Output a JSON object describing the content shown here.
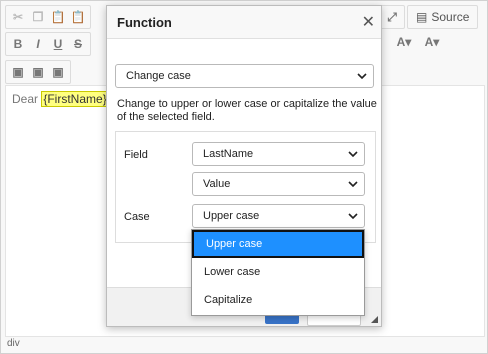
{
  "toolbar": {
    "source_label": "Source"
  },
  "content": {
    "text_before": "Dear ",
    "placeholder": "{FirstName}"
  },
  "statusbar": {
    "path": "div"
  },
  "dialog": {
    "title": "Function",
    "close_glyph": "✕",
    "function_select": "Change case",
    "description": "Change to upper or lower case or capitalize the value of the selected field.",
    "field_label": "Field",
    "field_select": "LastName",
    "value_select": "Value",
    "case_label": "Case",
    "case_select": "Upper case"
  },
  "dropdown": {
    "options": [
      "Upper case",
      "Lower case",
      "Capitalize"
    ],
    "highlighted": "Upper case"
  },
  "colors": {
    "accent": "#1e90ff",
    "placeholder_bg": "#ffff80"
  }
}
